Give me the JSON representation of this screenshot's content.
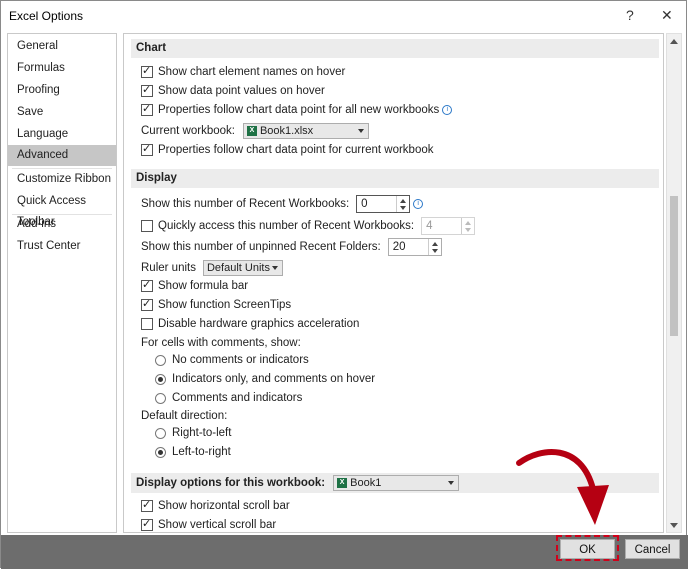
{
  "window": {
    "title": "Excel Options",
    "help_glyph": "?",
    "close_glyph": "✕"
  },
  "sidebar": {
    "items": [
      {
        "label": "General"
      },
      {
        "label": "Formulas"
      },
      {
        "label": "Proofing"
      },
      {
        "label": "Save"
      },
      {
        "label": "Language"
      },
      {
        "label": "Advanced",
        "selected": true
      },
      {
        "label": "Customize Ribbon"
      },
      {
        "label": "Quick Access Toolbar"
      },
      {
        "label": "Add-ins"
      },
      {
        "label": "Trust Center"
      }
    ]
  },
  "chart_section": {
    "header": "Chart",
    "show_element_names": "Show chart element names on hover",
    "show_point_values": "Show data point values on hover",
    "properties_follow_all": "Properties follow chart data point for all new workbooks",
    "current_workbook_label": "Current workbook:",
    "current_workbook_value": "Book1.xlsx",
    "properties_follow_current": "Properties follow chart data point for current workbook"
  },
  "display_section": {
    "header": "Display",
    "recent_workbooks_label": "Show this number of Recent Workbooks:",
    "recent_workbooks_value": "0",
    "quick_access_label": "Quickly access this number of Recent Workbooks:",
    "quick_access_value": "4",
    "unpinned_folders_label": "Show this number of unpinned Recent Folders:",
    "unpinned_folders_value": "20",
    "ruler_units_label": "Ruler units",
    "ruler_units_value": "Default Units",
    "show_formula_bar": "Show formula bar",
    "show_screentips": "Show function ScreenTips",
    "disable_hw_accel": "Disable hardware graphics acceleration",
    "comments_label": "For cells with comments, show:",
    "comments_none": "No comments or indicators",
    "comments_indicators": "Indicators only, and comments on hover",
    "comments_all": "Comments and indicators",
    "direction_label": "Default direction:",
    "direction_rtl": "Right-to-left",
    "direction_ltr": "Left-to-right"
  },
  "workbook_section": {
    "header": "Display options for this workbook:",
    "workbook_value": "Book1",
    "show_horizontal_scroll": "Show horizontal scroll bar",
    "show_vertical_scroll": "Show vertical scroll bar"
  },
  "buttons": {
    "ok": "OK",
    "cancel": "Cancel"
  },
  "colors": {
    "annotation_red": "#d0021b",
    "excel_green": "#1e7145",
    "selected_nav": "#c6c6c6"
  }
}
